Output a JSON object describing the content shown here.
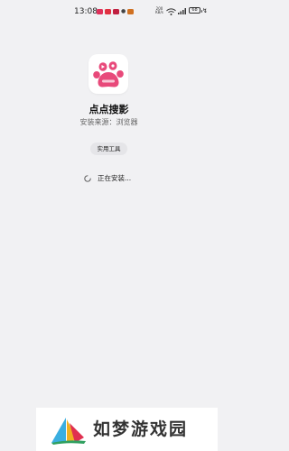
{
  "status_bar": {
    "time": "13:08",
    "network_speed": "200 KB/s",
    "battery": "68",
    "notification_colors": [
      "#e0305a",
      "#e03040",
      "#c02040",
      "#d07020"
    ]
  },
  "app": {
    "icon": "paw-icon",
    "icon_color": "#e8497a",
    "name": "点点搜影",
    "source": "安装来源：浏览器",
    "category": "实用工具"
  },
  "install": {
    "status_text": "正在安装..."
  },
  "watermark": {
    "text": "如梦游戏园",
    "logo_colors": [
      "#3aaee0",
      "#f0b020",
      "#e03050",
      "#30a060"
    ]
  }
}
